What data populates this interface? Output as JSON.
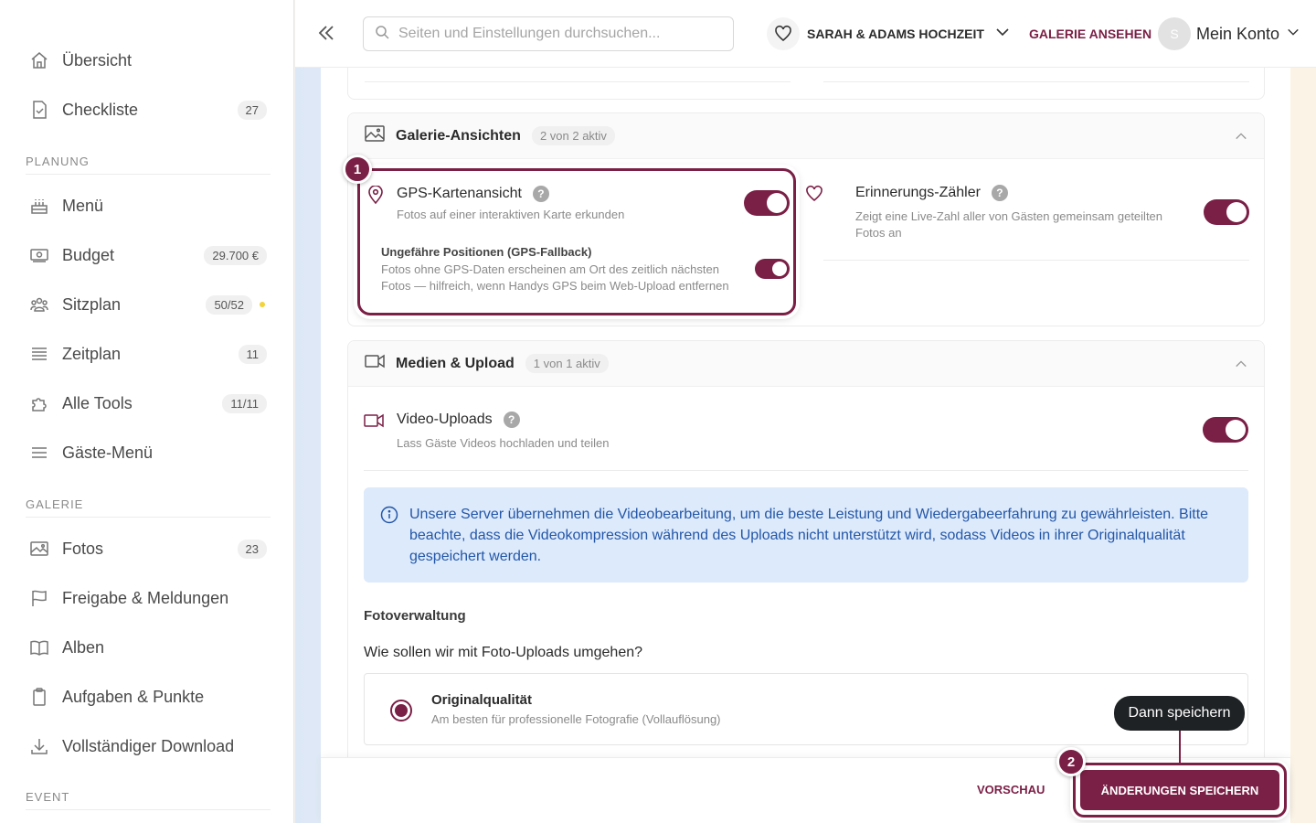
{
  "sidebar": {
    "items_top": [
      {
        "label": "Übersicht",
        "badge": "",
        "icon": "home-icon"
      },
      {
        "label": "Checkliste",
        "badge": "27",
        "icon": "checklist-icon"
      }
    ],
    "sections": [
      {
        "heading": "PLANUNG"
      },
      {
        "heading": "GALERIE"
      },
      {
        "heading": "EVENT"
      }
    ],
    "planning": [
      {
        "label": "Menü",
        "badge": "",
        "icon": "cake-icon"
      },
      {
        "label": "Budget",
        "badge": "29.700 €",
        "icon": "money-icon"
      },
      {
        "label": "Sitzplan",
        "badge": "50/52",
        "icon": "people-icon"
      },
      {
        "label": "Zeitplan",
        "badge": "11",
        "icon": "list-icon"
      },
      {
        "label": "Alle Tools",
        "badge": "11/11",
        "icon": "puzzle-icon"
      },
      {
        "label": "Gäste-Menü",
        "badge": "",
        "icon": "menu-icon"
      }
    ],
    "gallery": [
      {
        "label": "Fotos",
        "badge": "23",
        "icon": "image-icon"
      },
      {
        "label": "Freigabe & Meldungen",
        "badge": "",
        "icon": "flag-icon"
      },
      {
        "label": "Alben",
        "badge": "",
        "icon": "book-icon"
      },
      {
        "label": "Aufgaben & Punkte",
        "badge": "",
        "icon": "clipboard-icon"
      },
      {
        "label": "Vollständiger Download",
        "badge": "",
        "icon": "download-icon"
      }
    ]
  },
  "topbar": {
    "search_placeholder": "Seiten und Einstellungen durchsuchen...",
    "wedding_name": "SARAH & ADAMS HOCHZEIT",
    "gallery_link": "GALERIE ANSEHEN",
    "avatar_initial": "S",
    "account_label": "Mein Konto"
  },
  "gallery_views": {
    "title": "Galerie-Ansichten",
    "status": "2 von 2 aktiv",
    "gps": {
      "title": "GPS-Kartenansicht",
      "desc": "Fotos auf einer interaktiven Karte erkunden",
      "enabled": true,
      "fallback_title": "Ungefähre Positionen (GPS-Fallback)",
      "fallback_desc": "Fotos ohne GPS-Daten erscheinen am Ort des zeitlich nächsten Fotos — hilfreich, wenn Handys GPS beim Web-Upload entfernen",
      "fallback_enabled": true
    },
    "memory": {
      "title": "Erinnerungs-Zähler",
      "desc": "Zeigt eine Live-Zahl aller von Gästen gemeinsam geteilten Fotos an",
      "enabled": true
    }
  },
  "media_upload": {
    "title": "Medien & Upload",
    "status": "1 von 1 aktiv",
    "video": {
      "title": "Video-Uploads",
      "desc": "Lass Gäste Videos hochladen und teilen",
      "enabled": true
    },
    "info": "Unsere Server übernehmen die Videobearbeitung, um die beste Leistung und Wiedergabeerfahrung zu gewährleisten. Bitte beachte, dass die Videokompression während des Uploads nicht unterstützt wird, sodass Videos in ihrer Originalqualität gespeichert werden."
  },
  "photo_management": {
    "section_title": "Fotoverwaltung",
    "question": "Wie sollen wir mit Foto-Uploads umgehen?",
    "option_title": "Originalqualität",
    "option_desc": "Am besten für professionelle Fotografie (Vollauflösung)"
  },
  "footer": {
    "preview": "VORSCHAU",
    "save": "ÄNDERUNGEN SPEICHERN"
  },
  "tutorial": {
    "step1": "1",
    "step2": "2",
    "tooltip": "Dann speichern"
  },
  "colors": {
    "brand": "#7a1f45",
    "info_bg": "#dceafb",
    "info_text": "#2456a8"
  }
}
